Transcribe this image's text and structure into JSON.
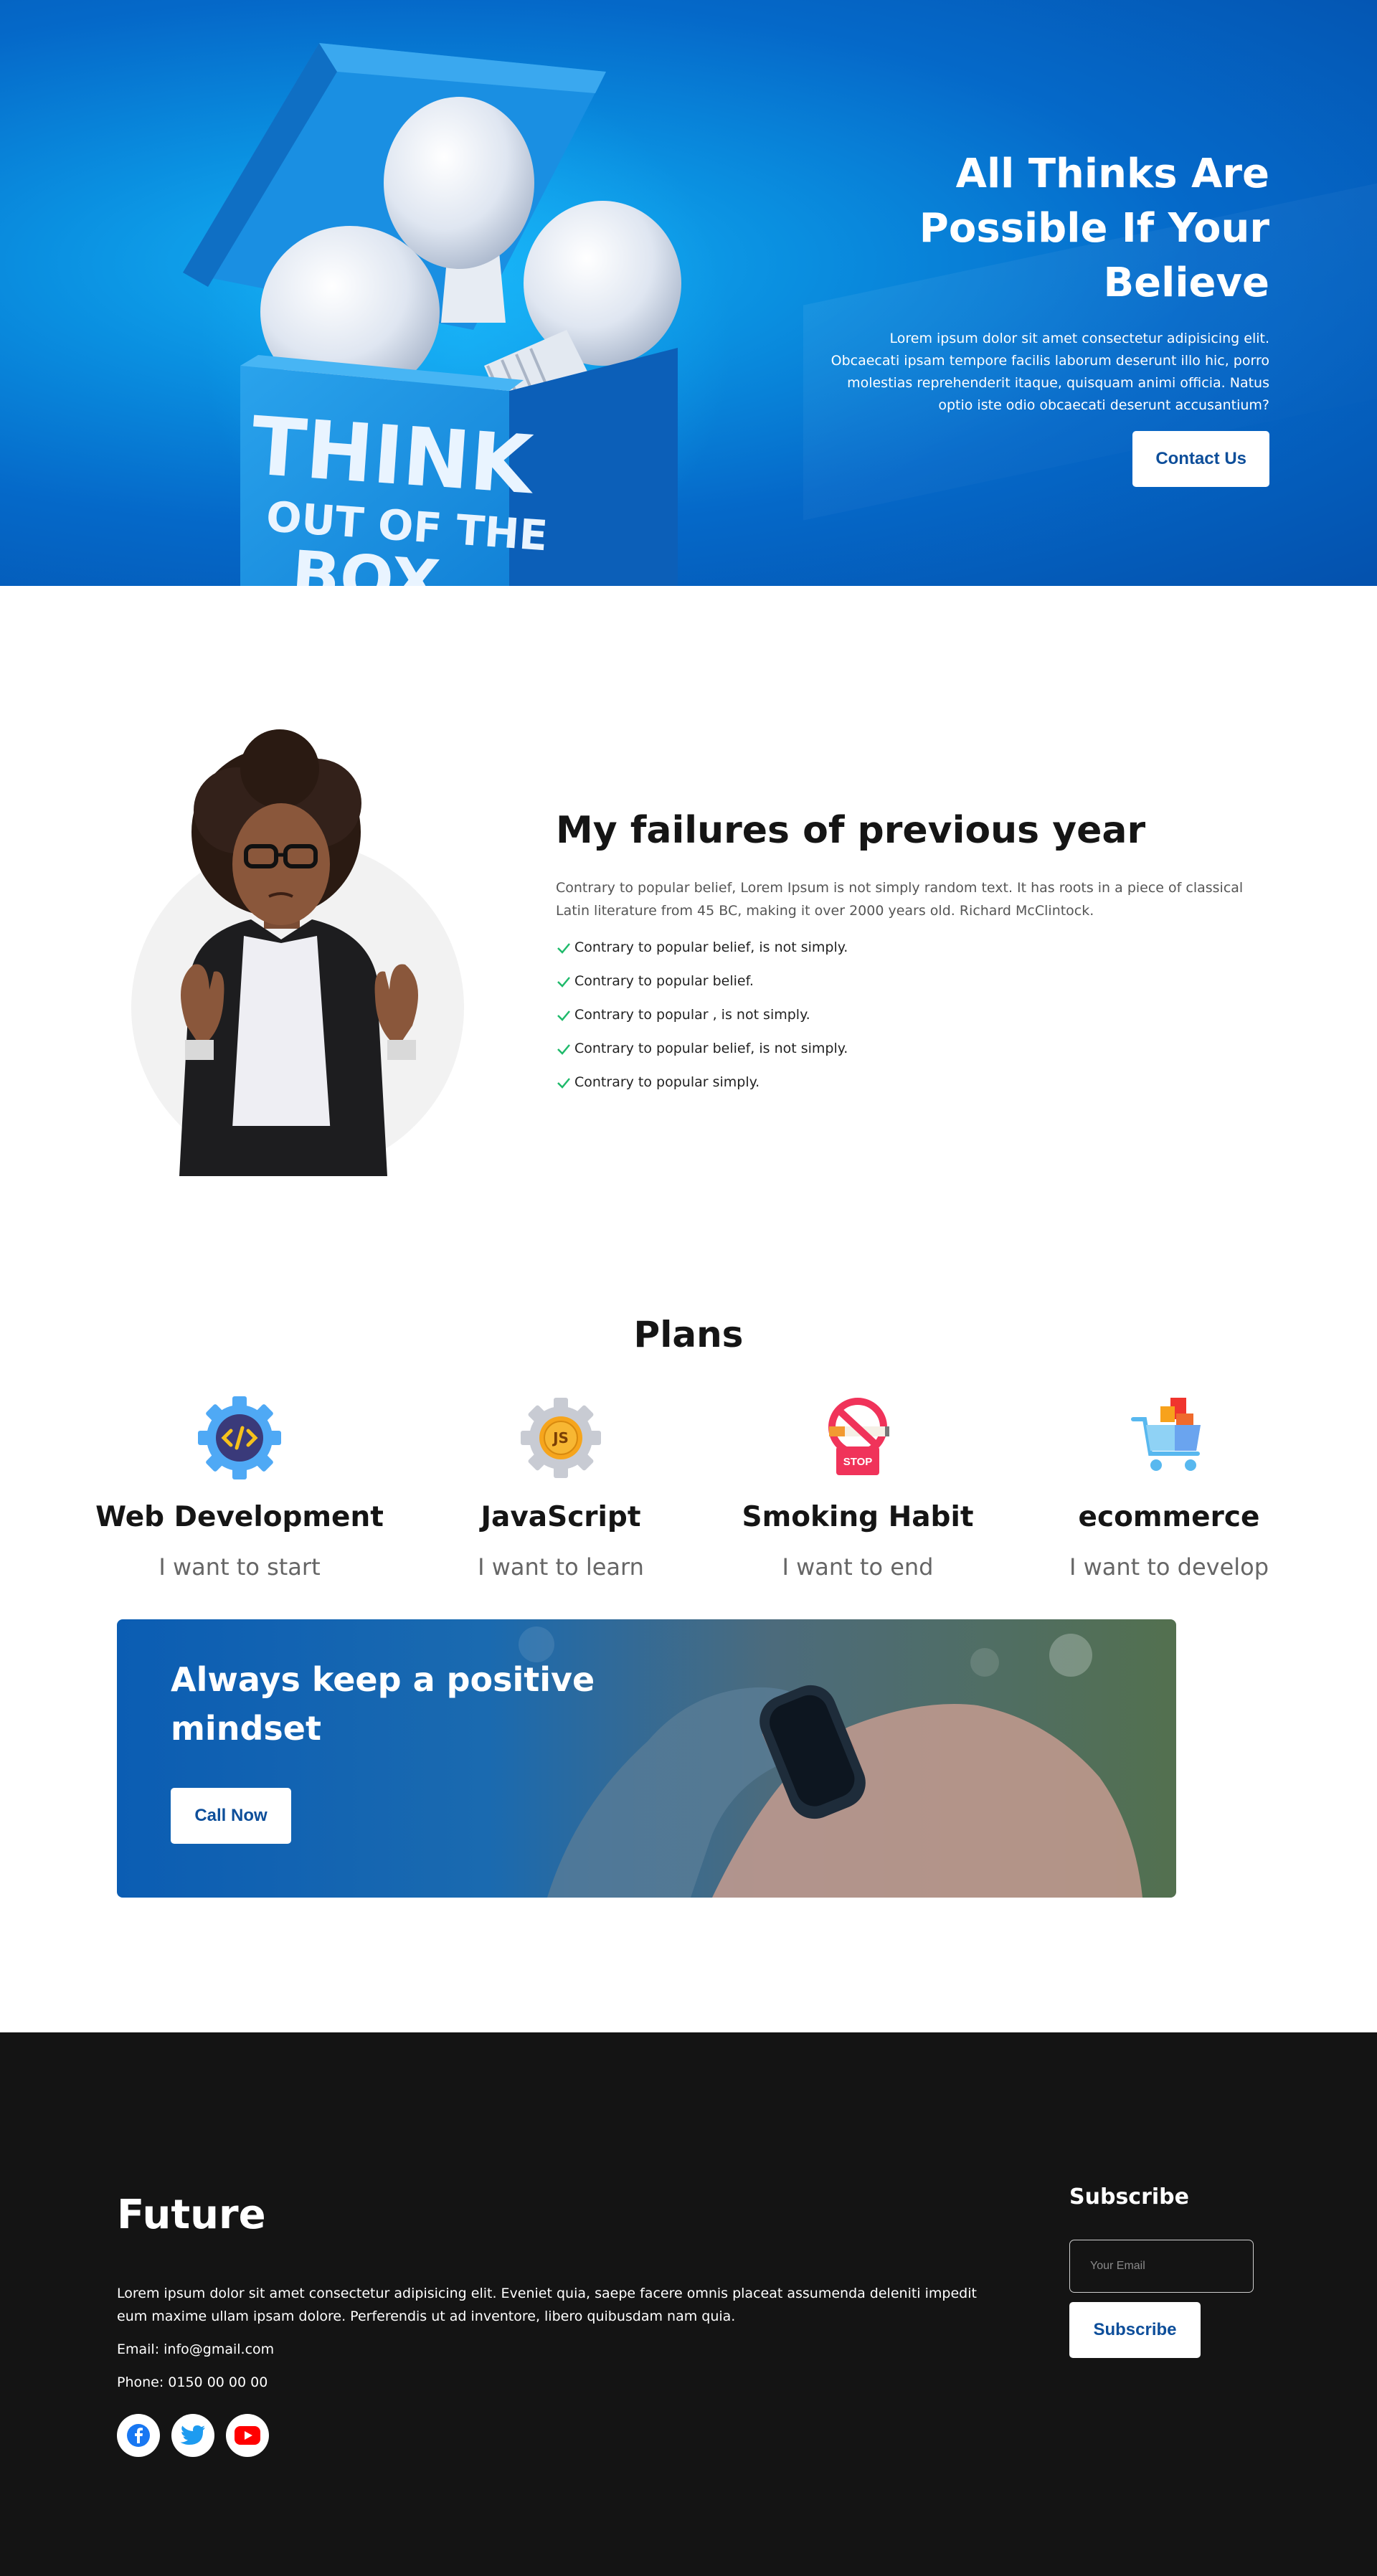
{
  "hero": {
    "title": "All Thinks Are Possible If Your Believe",
    "text": "Lorem ipsum dolor sit amet consectetur adipisicing elit. Obcaecati ipsam tempore facilis laborum deserunt illo hic, porro molestias reprehenderit itaque, quisquam animi officia. Natus optio iste odio obcaecati deserunt accusantium?",
    "button": "Contact Us",
    "box_text": [
      "THINK",
      "OUT OF THE",
      "BOX"
    ]
  },
  "failures": {
    "title": "My failures of previous year",
    "text": "Contrary to popular belief, Lorem Ipsum is not simply random text. It has roots in a piece of classical Latin literature from 45 BC, making it over 2000 years old. Richard McClintock.",
    "items": [
      "Contrary to popular belief, is not simply.",
      "Contrary to popular belief.",
      "Contrary to popular , is not simply.",
      "Contrary to popular belief, is not simply.",
      "Contrary to popular simply."
    ]
  },
  "plans": {
    "title": "Plans",
    "items": [
      {
        "icon": "code-gear-icon",
        "title": "Web Development",
        "subtitle": "I want to start"
      },
      {
        "icon": "js-gear-icon",
        "title": "JavaScript",
        "subtitle": "I want to learn"
      },
      {
        "icon": "no-smoking-icon",
        "title": "Smoking Habit",
        "subtitle": "I want to end",
        "badge": "STOP"
      },
      {
        "icon": "shopping-cart-icon",
        "title": "ecommerce",
        "subtitle": "I want to develop"
      }
    ]
  },
  "cta": {
    "title": "Always keep a positive mindset",
    "button": "Call Now"
  },
  "footer": {
    "brand": "Future",
    "text": "Lorem ipsum dolor sit amet consectetur adipisicing elit. Eveniet quia, saepe facere omnis placeat assumenda deleniti impedit eum maxime ullam ipsam dolore. Perferendis ut ad inventore, libero quibusdam nam quia.",
    "email": "Email: info@gmail.com",
    "phone": "Phone: 0150 00 00 00",
    "socials": [
      "facebook-icon",
      "twitter-icon",
      "youtube-icon"
    ],
    "subscribe": {
      "title": "Subscribe",
      "placeholder": "Your Email",
      "button": "Subscribe"
    }
  },
  "colors": {
    "brand_blue": "#0d4e9a",
    "hero_blue": "#0569c9",
    "footer_bg": "#141414",
    "check_green": "#1fba6b"
  }
}
